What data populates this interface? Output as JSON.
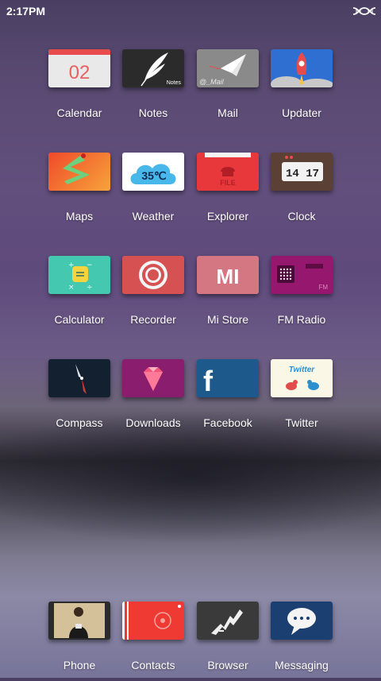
{
  "status_bar": {
    "time": "2:17PM",
    "icon": "dna-icon"
  },
  "apps": [
    {
      "label": "Calendar",
      "icon": "calendar-icon",
      "tile_text": "02",
      "color": "#e9e9ea"
    },
    {
      "label": "Notes",
      "icon": "feather-icon",
      "tile_text": "Notes",
      "color": "#2b2b2b"
    },
    {
      "label": "Mail",
      "icon": "paper-plane-icon",
      "tile_text": "@_Mail",
      "color": "#8a8a8a"
    },
    {
      "label": "Updater",
      "icon": "rocket-icon",
      "color": "#2f6fd1"
    },
    {
      "label": "Maps",
      "icon": "map-pin-icon",
      "color": "#f25a2a"
    },
    {
      "label": "Weather",
      "icon": "cloud-icon",
      "tile_text": "35℃",
      "color": "#ffffff"
    },
    {
      "label": "Explorer",
      "icon": "folder-icon",
      "tile_text": "FILE",
      "color": "#e8383c"
    },
    {
      "label": "Clock",
      "icon": "clock-icon",
      "tile_text": "14 17",
      "color": "#5a4035"
    },
    {
      "label": "Calculator",
      "icon": "calculator-icon",
      "color": "#44c9b0"
    },
    {
      "label": "Recorder",
      "icon": "recorder-icon",
      "color": "#d55152"
    },
    {
      "label": "Mi Store",
      "icon": "mi-store-icon",
      "tile_text": "MI",
      "color": "#d47782"
    },
    {
      "label": "FM Radio",
      "icon": "radio-icon",
      "tile_text": "FM",
      "color": "#96176e"
    },
    {
      "label": "Compass",
      "icon": "compass-icon",
      "color": "#132030"
    },
    {
      "label": "Downloads",
      "icon": "gem-icon",
      "color": "#8b1d6f"
    },
    {
      "label": "Facebook",
      "icon": "facebook-icon",
      "tile_text": "f",
      "color": "#1d5a8b"
    },
    {
      "label": "Twitter",
      "icon": "twitter-icon",
      "tile_text": "Twitter",
      "color": "#fbf7e6"
    }
  ],
  "dock": [
    {
      "label": "Phone",
      "icon": "photo-icon",
      "color": "#d4c19a"
    },
    {
      "label": "Contacts",
      "icon": "contacts-icon",
      "color": "#ee3a32"
    },
    {
      "label": "Browser",
      "icon": "browser-icon",
      "color": "#3a3a3a"
    },
    {
      "label": "Messaging",
      "icon": "chat-bubble-icon",
      "color": "#1a3f70"
    }
  ]
}
